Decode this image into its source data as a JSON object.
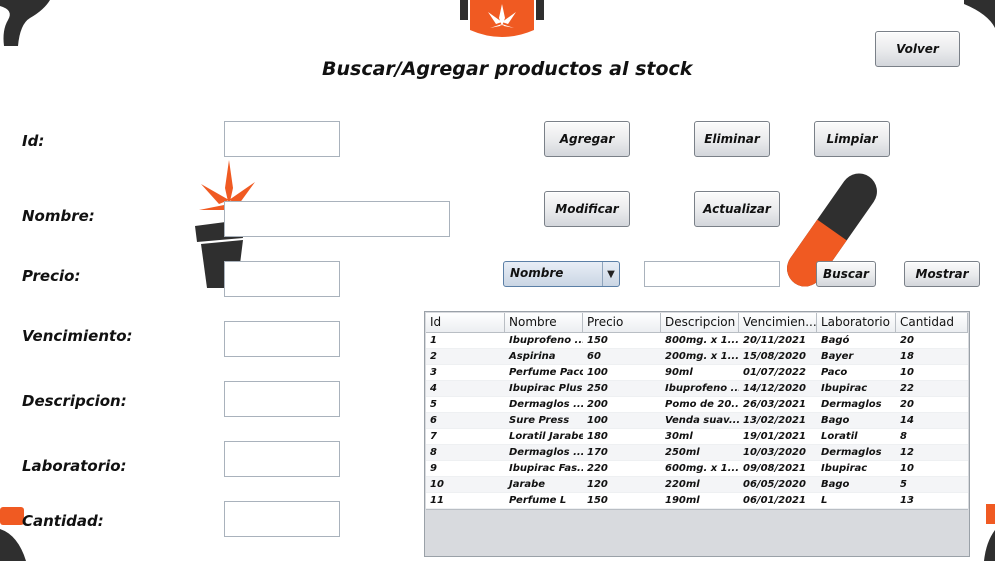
{
  "window": {
    "title": "Buscar/Agregar productos al stock",
    "volver_label": "Volver"
  },
  "form": {
    "id_label": "Id:",
    "nombre_label": "Nombre:",
    "precio_label": "Precio:",
    "vencimiento_label": "Vencimiento:",
    "descripcion_label": "Descripcion:",
    "laboratorio_label": "Laboratorio:",
    "cantidad_label": "Cantidad:",
    "id_value": "",
    "nombre_value": "",
    "precio_value": "",
    "vencimiento_value": "",
    "descripcion_value": "",
    "laboratorio_value": "",
    "cantidad_value": ""
  },
  "actions": {
    "agregar": "Agregar",
    "eliminar": "Eliminar",
    "limpiar": "Limpiar",
    "modificar": "Modificar",
    "actualizar": "Actualizar"
  },
  "search": {
    "field_selected": "Nombre",
    "query": "",
    "buscar": "Buscar",
    "mostrar": "Mostrar"
  },
  "table": {
    "columns": [
      "Id",
      "Nombre",
      "Precio",
      "Descripcion",
      "Vencimien...",
      "Laboratorio",
      "Cantidad"
    ],
    "rows": [
      [
        "1",
        "Ibuprofeno ...",
        "150",
        "800mg. x 1...",
        "20/11/2021",
        "Bagó",
        "20"
      ],
      [
        "2",
        "Aspirina",
        "60",
        "200mg. x 1...",
        "15/08/2020",
        "Bayer",
        "18"
      ],
      [
        "3",
        "Perfume Paco",
        "100",
        "90ml",
        "01/07/2022",
        "Paco",
        "10"
      ],
      [
        "4",
        "Ibupirac Plus",
        "250",
        "Ibuprofeno ...",
        "14/12/2020",
        "Ibupirac",
        "22"
      ],
      [
        "5",
        "Dermaglos ...",
        "200",
        "Pomo de 20...",
        "26/03/2021",
        "Dermaglos",
        "20"
      ],
      [
        "6",
        "Sure Press",
        "100",
        "Venda suav...",
        "13/02/2021",
        "Bago",
        "14"
      ],
      [
        "7",
        "Loratil Jarabe",
        "180",
        "30ml",
        "19/01/2021",
        "Loratil",
        "8"
      ],
      [
        "8",
        "Dermaglos ...",
        "170",
        "250ml",
        "10/03/2020",
        "Dermaglos",
        "12"
      ],
      [
        "9",
        "Ibupirac Fas...",
        "220",
        "600mg. x 1...",
        "09/08/2021",
        "Ibupirac",
        "10"
      ],
      [
        "10",
        "Jarabe",
        "120",
        "220ml",
        "06/05/2020",
        "Bago",
        "5"
      ],
      [
        "11",
        "Perfume L",
        "150",
        "190ml",
        "06/01/2021",
        "L",
        "13"
      ]
    ]
  },
  "colors": {
    "accent_orange": "#f05a22",
    "dark_gray": "#3a3a3a"
  },
  "icons": {
    "logo": "cannabis-leaf-badge-icon",
    "plant": "potted-leaf-icon",
    "pill": "capsule-icon"
  }
}
